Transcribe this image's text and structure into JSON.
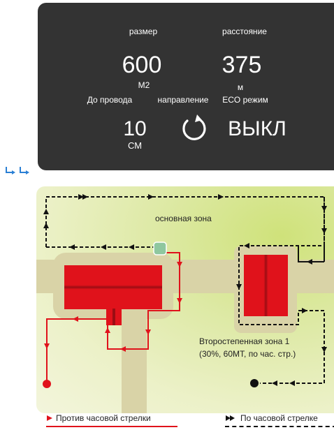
{
  "status": {
    "size_label": "размер",
    "distance_label": "расстояние",
    "size_value": "600",
    "size_unit": "M2",
    "distance_value": "375",
    "distance_unit": "м",
    "wire_label": "До провода",
    "direction_label": "направление",
    "eco_label": "ECO режим",
    "wire_value": "10",
    "wire_unit": "СМ",
    "eco_value": "ВЫКЛ",
    "direction_icon": "rotate-clockwise-icon"
  },
  "map": {
    "main_zone_label": "основная зона",
    "secondary_zone_line1": "Второстепенная зона 1",
    "secondary_zone_line2": "(30%, 60МТ, по час. стр.)"
  },
  "legend": {
    "counterclockwise": "Против часовой стрелки",
    "clockwise": "По часовой стрелке"
  },
  "colors": {
    "panel_bg": "#333333",
    "accent_red": "#e0121b",
    "accent_blue": "#2a7fd4",
    "grass": "#dde9a4",
    "path": "#d9d3a7",
    "charging_station": "#8fc79f"
  }
}
